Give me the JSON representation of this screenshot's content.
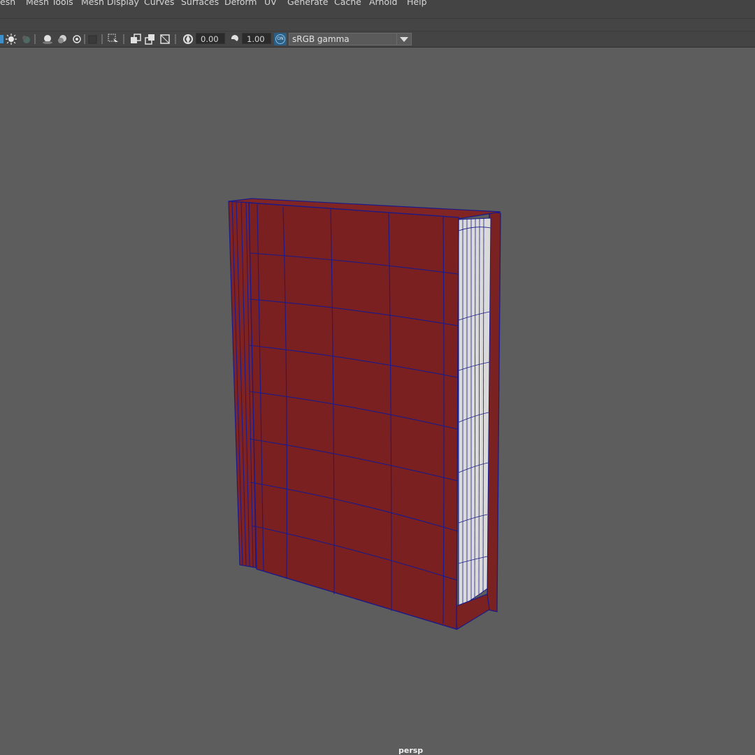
{
  "menubar": {
    "items": [
      "esh",
      "Mesh Tools",
      "Mesh Display",
      "Curves",
      "Surfaces",
      "Deform",
      "UV",
      "Generate",
      "Cache",
      "Arnold",
      "Help"
    ]
  },
  "toolbar": {
    "icons": [
      "isolate-icon",
      "light-icon",
      "shadow-icon",
      "sphere-shaded-icon",
      "sphere-wire-icon",
      "xray-icon",
      "square-icon",
      "split-icon",
      "select-icon",
      "split-icon",
      "copy-icon",
      "swap-icon",
      "frame-icon",
      "split-icon",
      "exposure-icon",
      "gamma-icon"
    ],
    "exposure_value": "0.00",
    "gamma_value": "1.00",
    "color_mgmt_badge": "ON",
    "color_space": "sRGB gamma"
  },
  "viewport": {
    "camera": "persp",
    "background_color": "#5d5d5d",
    "model": {
      "name": "book",
      "cover_color": "#7a2020",
      "pages_color": "#d9d9d9",
      "wireframe_color": "#1a1a8a"
    }
  }
}
